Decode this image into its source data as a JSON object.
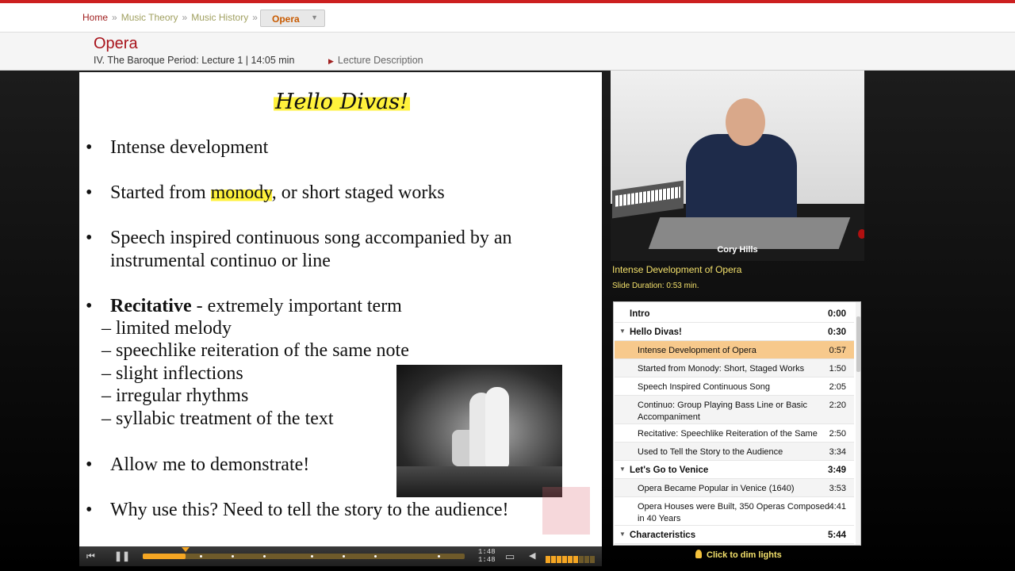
{
  "breadcrumb": {
    "home": "Home",
    "music_theory": "Music Theory",
    "music_history": "Music History",
    "current": "Opera"
  },
  "header": {
    "title": "Opera",
    "subtitle": "IV. The Baroque Period: Lecture 1 | 14:05 min",
    "description_link": "Lecture Description"
  },
  "slide": {
    "title": "Hello Divas!",
    "b1": "Intense development",
    "b2_pre": "Started from ",
    "b2_hl": "monody",
    "b2_post": ", or short staged works",
    "b3_l1": "Speech inspired continuous song accompanied by an",
    "b3_l2": "instrumental continuo or line",
    "b4_bold": "Recitative",
    "b4_rest": " - extremely important term",
    "s1": "– limited melody",
    "s2": "– speechlike reiteration of the same note",
    "s3": "– slight inflections",
    "s4": "– irregular rhythms",
    "s5": "– syllabic treatment of the text",
    "b5": "Allow me to demonstrate!",
    "b6": "Why use this? Need to tell the story to the audience!",
    "bullet": "•"
  },
  "player": {
    "time_current": "1:48",
    "time_total": "1:48",
    "progress": 0.133,
    "volume_level": 0.7
  },
  "video": {
    "presenter": "Cory Hills",
    "current_slide": "Intense Development of Opera",
    "duration": "Slide Duration: 0:53 min."
  },
  "toc": [
    {
      "label": "Intro",
      "time": "0:00",
      "kind": "section"
    },
    {
      "label": "Hello Divas!",
      "time": "0:30",
      "kind": "section",
      "expanded": true
    },
    {
      "label": "Intense Development of Opera",
      "time": "0:57",
      "kind": "active"
    },
    {
      "label": "Started from Monody: Short, Staged Works",
      "time": "1:50",
      "kind": "item"
    },
    {
      "label": "Speech Inspired Continuous Song",
      "time": "2:05",
      "kind": "item"
    },
    {
      "label": "Continuo: Group Playing Bass Line or Basic",
      "label2": "Accompaniment",
      "time": "2:20",
      "kind": "item"
    },
    {
      "label": "Recitative: Speechlike Reiteration of the Same",
      "time": "2:50",
      "kind": "item"
    },
    {
      "label": "Used to Tell the Story to the Audience",
      "time": "3:34",
      "kind": "item"
    },
    {
      "label": "Let's Go to Venice",
      "time": "3:49",
      "kind": "section",
      "expanded": true
    },
    {
      "label": "Opera Became Popular in Venice (1640)",
      "time": "3:53",
      "kind": "item"
    },
    {
      "label": "Opera Houses were Built, 350 Operas Composed",
      "label2": "in 40 Years",
      "time": "4:41",
      "kind": "item"
    },
    {
      "label": "Characteristics",
      "time": "5:44",
      "kind": "section",
      "expanded": true
    }
  ],
  "dim_lights": "Click to dim lights",
  "icons": {
    "prev": "skip-back-icon",
    "pause": "pause-icon",
    "fullscreen": "fullscreen-icon",
    "volume": "speaker-icon",
    "bulb": "lightbulb-icon"
  },
  "colors": {
    "brand_red": "#a8131b",
    "accent_orange": "#f5a623",
    "highlight_yellow": "#fff23c",
    "active_row": "#f7c98c"
  }
}
